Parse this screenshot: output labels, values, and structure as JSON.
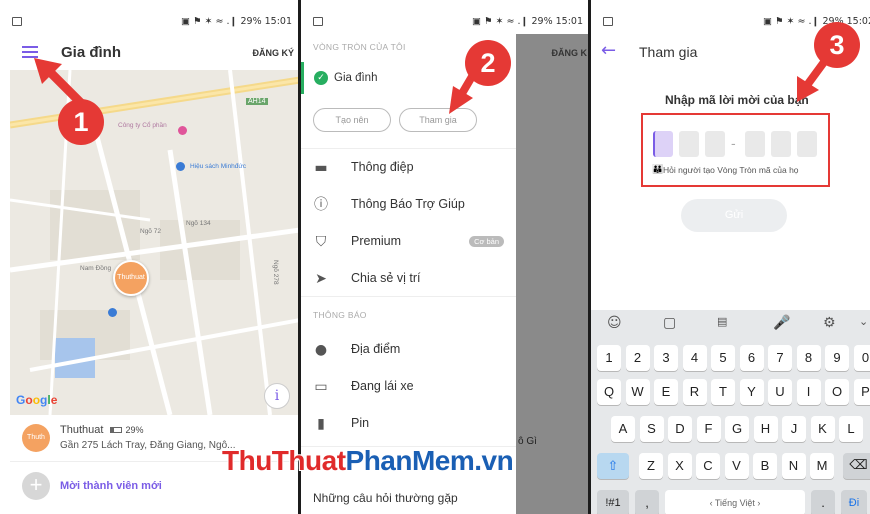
{
  "status_bar": {
    "time_1": "15:01",
    "time_2": "15:01",
    "time_3": "15:02",
    "battery": "29%",
    "display_1": "▣ ⚑ ✶ ≈ .❙ 29% 15:01",
    "display_2": "▣ ⚑ ✶ ≈ .❙ 29% 15:01",
    "display_3": "▣ ⚑ ✶ ≈ .❙ 29% 15:02"
  },
  "screen1": {
    "title": "Gia đình",
    "right_action": "ĐĂNG KÝ",
    "map": {
      "road_ah14": "AH14",
      "poi_1": "Công ty Cổ phần",
      "poi_2": "Hiệu sách Minhđức",
      "poi_3": "Ngõ 134",
      "poi_4": "Ngõ 72",
      "poi_5": "Nam Đồng",
      "poi_6": "Ngõ 278",
      "avatar_label": "Thuthuat",
      "google": "Google"
    },
    "member": {
      "avatar": "Thuth",
      "name": "Thuthuat",
      "battery": "29%",
      "address": "Gần 275 Lách Tray, Đằng Giang, Ngô..."
    },
    "new_member": "Mời thành viên mới"
  },
  "screen2": {
    "section_circle": "VÒNG TRÒN CỦA TÔI",
    "circle_name": "Gia đình",
    "btn_create": "Tạo nên",
    "btn_join": "Tham gia",
    "right_action": "ĐĂNG K",
    "menu": [
      {
        "icon": "message-icon",
        "label": "Thông điệp"
      },
      {
        "icon": "alert-icon",
        "label": "Thông Báo Trợ Giúp"
      },
      {
        "icon": "shield-icon",
        "label": "Premium",
        "badge": "Cơ bản"
      },
      {
        "icon": "location-arrow-icon",
        "label": "Chia sẻ vị trí"
      }
    ],
    "section_notify": "THÔNG BÁO",
    "notify": [
      {
        "icon": "place-icon",
        "label": "Địa điểm"
      },
      {
        "icon": "car-icon",
        "label": "Đang lái xe"
      },
      {
        "icon": "battery-icon",
        "label": "Pin"
      }
    ],
    "faq": "Những câu hỏi thường gặp",
    "bg_fragment": "ô Gì"
  },
  "screen3": {
    "title": "Tham gia",
    "prompt": "Nhập mã lời mời của bạn",
    "dash": "-",
    "hint": "Hỏi người tạo Vòng Tròn mã của họ",
    "submit": "Gửi",
    "keyboard": {
      "row_numbers": [
        "1",
        "2",
        "3",
        "4",
        "5",
        "6",
        "7",
        "8",
        "9",
        "0"
      ],
      "row_1": [
        "Q",
        "W",
        "E",
        "R",
        "T",
        "Y",
        "U",
        "I",
        "O",
        "P"
      ],
      "row_2": [
        "A",
        "S",
        "D",
        "F",
        "G",
        "H",
        "J",
        "K",
        "L"
      ],
      "row_3": [
        "Z",
        "X",
        "C",
        "V",
        "B",
        "N",
        "M"
      ],
      "sym": "!#1",
      "comma": ",",
      "space": "‹ Tiếng Việt ›",
      "period": ".",
      "go": "Đi",
      "shift": "⇧",
      "backspace": "⌫"
    }
  },
  "steps": [
    "1",
    "2",
    "3"
  ],
  "watermark": {
    "part1": "ThuThuat",
    "part2": "PhanMem",
    "part3": ".vn"
  },
  "colors": {
    "accent": "#7a5ce6",
    "badge_red": "#e53935",
    "green_check": "#27ae60",
    "watermark_red": "#e02b2b",
    "watermark_blue": "#1a5fb4"
  }
}
